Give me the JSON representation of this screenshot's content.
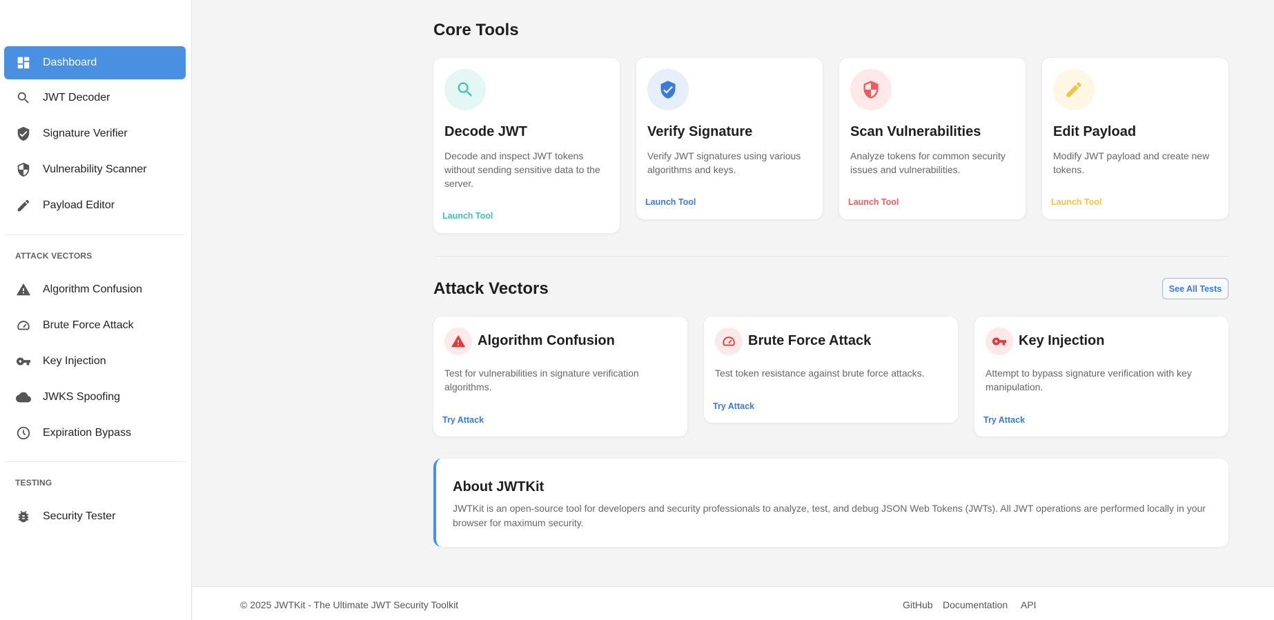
{
  "sidebar": {
    "items": [
      {
        "label": "Dashboard",
        "icon": "dashboard-icon",
        "active": true
      },
      {
        "label": "JWT Decoder",
        "icon": "search-icon"
      },
      {
        "label": "Signature Verifier",
        "icon": "verified-shield-icon"
      },
      {
        "label": "Vulnerability Scanner",
        "icon": "security-shield-icon"
      },
      {
        "label": "Payload Editor",
        "icon": "pencil-icon"
      }
    ],
    "attack_section": "ATTACK VECTORS",
    "attack_items": [
      {
        "label": "Algorithm Confusion",
        "icon": "warning-icon"
      },
      {
        "label": "Brute Force Attack",
        "icon": "speedometer-icon"
      },
      {
        "label": "Key Injection",
        "icon": "key-icon"
      },
      {
        "label": "JWKS Spoofing",
        "icon": "cloud-icon"
      },
      {
        "label": "Expiration Bypass",
        "icon": "clock-icon"
      }
    ],
    "testing_section": "TESTING",
    "testing_items": [
      {
        "label": "Security Tester",
        "icon": "bug-icon"
      }
    ]
  },
  "core_tools": {
    "title": "Core Tools",
    "cards": [
      {
        "title": "Decode JWT",
        "desc": "Decode and inspect JWT tokens without sending sensitive data to the server.",
        "link": "Launch Tool",
        "icon": "search-icon",
        "color": "#3cc2b3"
      },
      {
        "title": "Verify Signature",
        "desc": "Verify JWT signatures using various algorithms and keys.",
        "link": "Launch Tool",
        "icon": "verified-shield-icon",
        "color": "#3a7bd5"
      },
      {
        "title": "Scan Vulnerabilities",
        "desc": "Analyze tokens for common security issues and vulnerabilities.",
        "link": "Launch Tool",
        "icon": "security-shield-icon",
        "color": "#ef5b5b"
      },
      {
        "title": "Edit Payload",
        "desc": "Modify JWT payload and create new tokens.",
        "link": "Launch Tool",
        "icon": "pencil-icon",
        "color": "#f5c242"
      }
    ]
  },
  "attack_vectors": {
    "title": "Attack Vectors",
    "see_all": "See All Tests",
    "cards": [
      {
        "title": "Algorithm Confusion",
        "desc": "Test for vulnerabilities in signature verification algorithms.",
        "link": "Try Attack",
        "icon": "warning-icon"
      },
      {
        "title": "Brute Force Attack",
        "desc": "Test token resistance against brute force attacks.",
        "link": "Try Attack",
        "icon": "speedometer-icon"
      },
      {
        "title": "Key Injection",
        "desc": "Attempt to bypass signature verification with key manipulation.",
        "link": "Try Attack",
        "icon": "key-icon"
      }
    ]
  },
  "about": {
    "title": "About JWTKit",
    "text": "JWTKit is an open-source tool for developers and security professionals to analyze, test, and debug JSON Web Tokens (JWTs). All JWT operations are performed locally in your browser for maximum security."
  },
  "footer": {
    "copyright": "© 2025 JWTKit - The Ultimate JWT Security Toolkit",
    "links": [
      "GitHub",
      "Documentation",
      "API"
    ]
  },
  "colors": {
    "accent": "#4a90e2",
    "danger": "#e53935",
    "link": "#3a7bd5"
  }
}
